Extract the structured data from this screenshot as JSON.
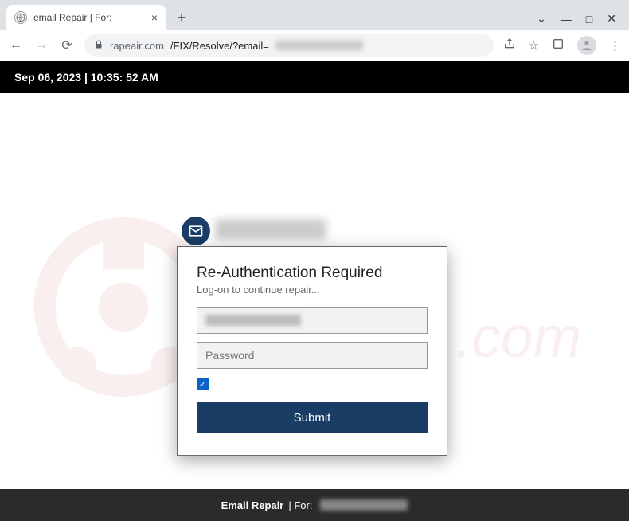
{
  "browser": {
    "tab_title": "email Repair | For:",
    "url_host": "rapeair.com",
    "url_path": "/FIX/Resolve/?email="
  },
  "header": {
    "datetime": "Sep 06, 2023 | 10:35: 52 AM"
  },
  "modal": {
    "heading": "Re-Authentication Required",
    "subtitle": "Log-on to continue repair...",
    "password_placeholder": "Password",
    "submit_label": "Submit",
    "remember_checked": true
  },
  "footer": {
    "label_bold": "Email Repair",
    "label_rest": " | For:"
  }
}
